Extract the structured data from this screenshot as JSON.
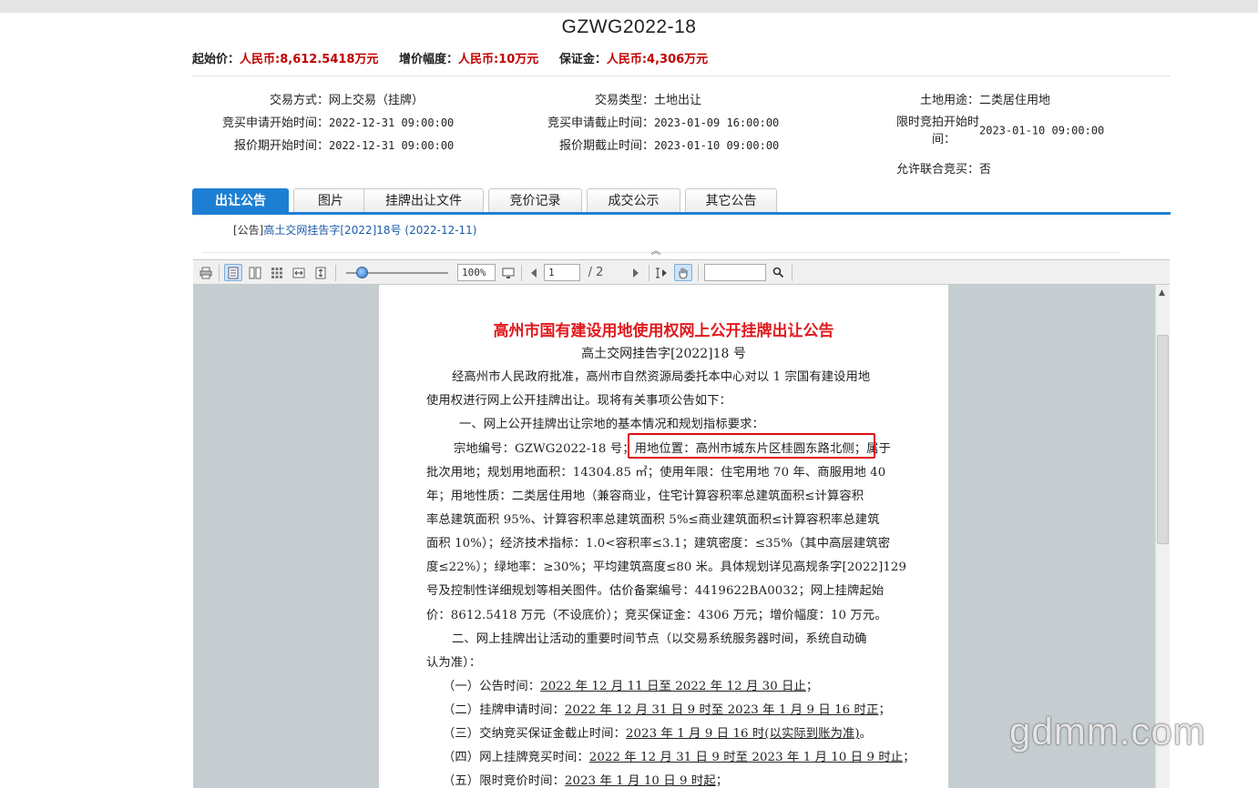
{
  "header": {
    "title": "GZWG2022-18",
    "prices": [
      {
        "label": "起始价：",
        "value": "人民币:8,612.5418万元"
      },
      {
        "label": "增价幅度：",
        "value": "人民币:10万元"
      },
      {
        "label": "保证金：",
        "value": "人民币:4,306万元"
      }
    ]
  },
  "info": {
    "trade_mode": {
      "label": "交易方式：",
      "value": "网上交易（挂牌）"
    },
    "apply_start": {
      "label": "竞买申请开始时间：",
      "value": "2022-12-31 09:00:00"
    },
    "quote_start": {
      "label": "报价期开始时间：",
      "value": "2022-12-31 09:00:00"
    },
    "trade_type": {
      "label": "交易类型：",
      "value": "土地出让"
    },
    "apply_end": {
      "label": "竞买申请截止时间：",
      "value": "2023-01-09 16:00:00"
    },
    "quote_end": {
      "label": "报价期截止时间：",
      "value": "2023-01-10 09:00:00"
    },
    "land_use": {
      "label": "土地用途：",
      "value": "二类居住用地"
    },
    "limit_start_1": "限时竞拍开始时",
    "limit_start_2": "间：",
    "limit_start_value": "2023-01-10 09:00:00",
    "joint_bid": {
      "label": "允许联合竞买：",
      "value": "否"
    }
  },
  "tabs": [
    "出让公告",
    "图片",
    "挂牌出让文件",
    "竞价记录",
    "成交公示",
    "其它公告"
  ],
  "notice": {
    "prefix": "[公告]",
    "link": "高土交网挂告字[2022]18号",
    "date": "(2022-12-11)"
  },
  "pdf_toolbar": {
    "zoom": "100%",
    "page": "1",
    "total": "/ 2"
  },
  "document": {
    "title": "高州市国有建设用地使用权网上公开挂牌出让公告",
    "subtitle": "高土交网挂告字[2022]18 号",
    "lines": [
      "经高州市人民政府批准，高州市自然资源局委托本中心对以 1 宗国有建设用地",
      "使用权进行网上公开挂牌出让。现将有关事项公告如下：",
      "一、网上公开挂牌出让宗地的基本情况和规划指标要求：",
      "宗地编号：GZWG2022-18 号；用地位置：高州市城东片区桂圆东路北侧；属于",
      "批次用地；规划用地面积：14304.85 ㎡；使用年限：住宅用地 70 年、商服用地 40",
      "年；用地性质：二类居住用地（兼容商业，住宅计算容积率总建筑面积≤计算容积",
      "率总建筑面积 95%、计算容积率总建筑面积 5%≤商业建筑面积≤计算容积率总建筑",
      "面积 10%）；经济技术指标：1.0<容积率≤3.1；建筑密度：≤35%（其中高层建筑密",
      "度≤22%）；绿地率：≥30%；平均建筑高度≤80 米。具体规划详见高规条字[2022]129",
      "号及控制性详细规划等相关图件。估价备案编号：4419622BA0032；网上挂牌起始",
      "价：8612.5418 万元（不设底价）；竞买保证金：4306 万元；增价幅度：10 万元。",
      "二、网上挂牌出让活动的重要时间节点（以交易系统服务器时间，系统自动确",
      "认为准）：",
      "（一）公告时间：2022 年 12 月 11 日至 2022 年 12 月 30 日止；",
      "（二）挂牌申请时间：2022 年 12 月 31 日 9 时至 2023 年 1 月 9 日 16 时正；",
      "（三）交纳竞买保证金截止时间：2023 年 1 月 9 日 16 时(以实际到账为准)。",
      "（四）网上挂牌竞买时间：2022 年 12 月 31 日 9 时至 2023 年 1 月 10 日 9 时止；",
      "（五）限时竞价时间：2023 年 1 月 10 日 9 时起；"
    ]
  },
  "watermark": "gdmm.com",
  "colors": {
    "accent": "#1d7fd3",
    "price_red": "#c00000",
    "doc_title_red": "#e0181c",
    "highlight_red": "#e01010"
  }
}
